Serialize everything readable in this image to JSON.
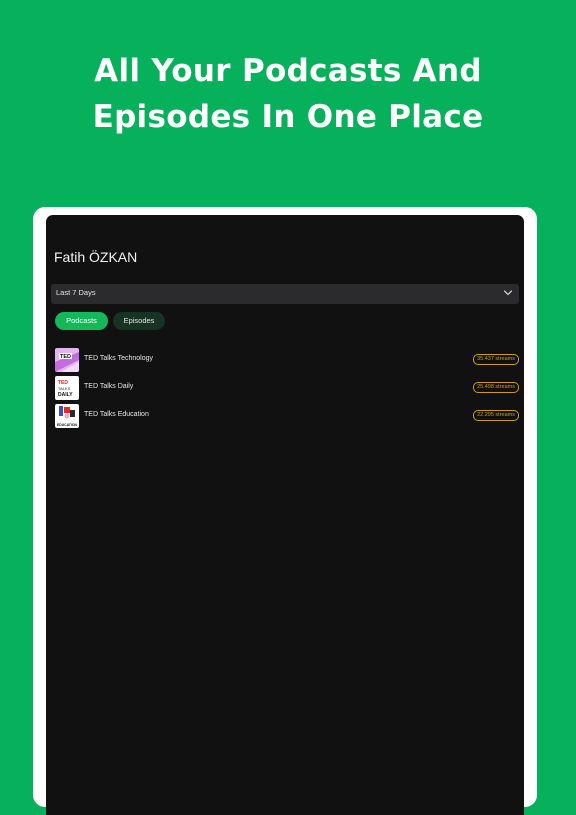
{
  "headline": {
    "line1": "All Your Podcasts And",
    "line2": "Episodes In One Place"
  },
  "colors": {
    "background": "#07b05a",
    "screen": "#111112",
    "accent": "#12b85a",
    "badge": "#d49a1e"
  },
  "app": {
    "user_name": "Fatih ÖZKAN",
    "range_select": {
      "value": "Last 7 Days",
      "icon": "chevron-down-icon"
    },
    "tabs": [
      {
        "label": "Podcasts",
        "active": true
      },
      {
        "label": "Episodes",
        "active": false
      }
    ],
    "podcasts": [
      {
        "title": "TED Talks Technology",
        "streams": "35.437 streams",
        "cover_text": "TED"
      },
      {
        "title": "TED Talks Daily",
        "streams": "25.498 streams",
        "cover_text": "TED TALKS DAILY"
      },
      {
        "title": "TED Talks Education",
        "streams": "22.295 streams",
        "cover_text": "TED EDUCATION"
      }
    ]
  }
}
